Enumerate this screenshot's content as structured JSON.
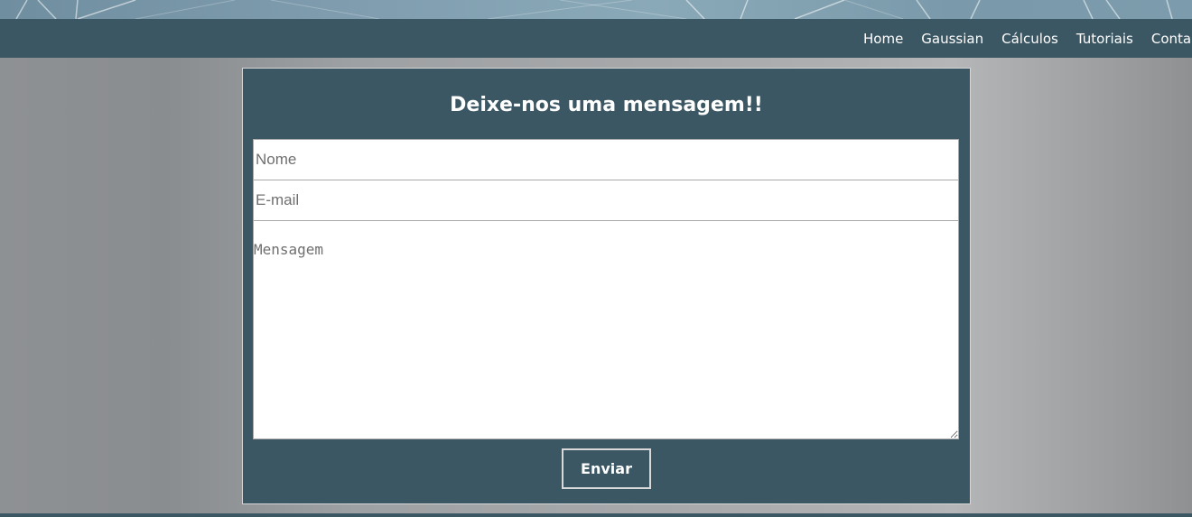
{
  "nav": {
    "items": [
      {
        "label": "Home"
      },
      {
        "label": "Gaussian"
      },
      {
        "label": "Cálculos"
      },
      {
        "label": "Tutoriais"
      },
      {
        "label": "Conta"
      }
    ]
  },
  "contact_form": {
    "title": "Deixe-nos uma mensagem!!",
    "name_placeholder": "Nome",
    "email_placeholder": "E-mail",
    "message_placeholder": "Mensagem",
    "submit_label": "Enviar"
  },
  "colors": {
    "primary": "#3b5764",
    "banner": "#7f9daf",
    "background": "#a6a8aa"
  }
}
